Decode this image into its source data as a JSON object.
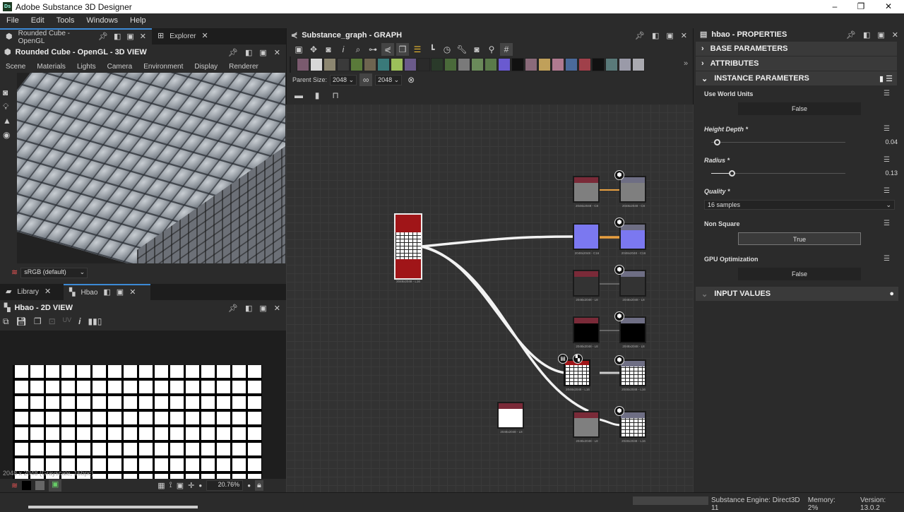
{
  "app": {
    "title": "Adobe Substance 3D Designer",
    "logo": "Ds",
    "minimize": "–",
    "maximize": "❐",
    "close": "✕"
  },
  "menu": [
    "File",
    "Edit",
    "Tools",
    "Windows",
    "Help"
  ],
  "top_left": {
    "tabs": [
      {
        "label": "Rounded Cube - OpenGL",
        "icon": "cube-icon"
      },
      {
        "label": "Explorer",
        "icon": "tree-icon"
      }
    ],
    "title": "Rounded Cube - OpenGL - 3D VIEW",
    "menus": [
      "Scene",
      "Materials",
      "Lights",
      "Camera",
      "Environment",
      "Display",
      "Renderer"
    ],
    "colorspace": "sRGB (default)"
  },
  "bottom_left": {
    "tabs": [
      {
        "label": "Library"
      },
      {
        "label": "Hbao"
      }
    ],
    "title": "Hbao - 2D VIEW",
    "uv_label": "UV",
    "image_info": "2048 x 2048 (Grayscale, 16bpc)",
    "zoom": "20.76%"
  },
  "graph": {
    "title": "Substance_graph - GRAPH",
    "parent_size_label": "Parent Size:",
    "width": "2048",
    "height": "2048",
    "library_colors": [
      "#7a5a6e",
      "#d8d8d8",
      "#8c8670",
      "#3a3a3a",
      "#5a7a3a",
      "#6e6450",
      "#3a7a7a",
      "#9cbf5a",
      "#6a5a8a",
      "#2a2a2a",
      "#2a3a2a",
      "#4a6a3a",
      "#7a7a7a",
      "#6a8a5a",
      "#5a7a4a",
      "#6a5ad0",
      "#111111",
      "#8a6a7a",
      "#c0a05a",
      "#b07a90",
      "#4a6a9a",
      "#a0404a",
      "#111111",
      "#5a7a7a",
      "#9a9aa8",
      "#aaaab0"
    ],
    "nodes": [
      {
        "label": "2048x2048 - L16"
      },
      {
        "label": "2048x2048 - C8"
      },
      {
        "label": "2048x2048 - C8"
      },
      {
        "label": "2048x2048 - C16"
      },
      {
        "label": "2048x2048 - C16"
      },
      {
        "label": "2048x2048 - L8"
      },
      {
        "label": "2048x2048 - L8"
      },
      {
        "label": "2048x2048 - L8"
      },
      {
        "label": "2048x2048 - L8"
      },
      {
        "label": "2048x2048 - L16"
      },
      {
        "label": "2048x2048 - L16"
      },
      {
        "label": "2048x2048 - L8"
      },
      {
        "label": "2048x2048 - L8"
      },
      {
        "label": "2048x2048 - L16"
      }
    ]
  },
  "properties": {
    "title": "hbao - PROPERTIES",
    "sections": {
      "base": "BASE PARAMETERS",
      "attributes": "ATTRIBUTES",
      "instance": "INSTANCE PARAMETERS",
      "inputs": "INPUT VALUES"
    },
    "use_world_units": {
      "label": "Use World Units",
      "value": "False"
    },
    "height_depth": {
      "label": "Height Depth *",
      "value": "0.04",
      "fraction": 0.04
    },
    "radius": {
      "label": "Radius *",
      "value": "0.13",
      "fraction": 0.13
    },
    "quality": {
      "label": "Quality *",
      "value": "16 samples"
    },
    "non_square": {
      "label": "Non Square",
      "value": "True"
    },
    "gpu_optimization": {
      "label": "GPU Optimization",
      "value": "False"
    }
  },
  "status": {
    "engine": "Substance Engine: Direct3D 11",
    "memory": "Memory: 2%",
    "version": "Version: 13.0.2"
  }
}
